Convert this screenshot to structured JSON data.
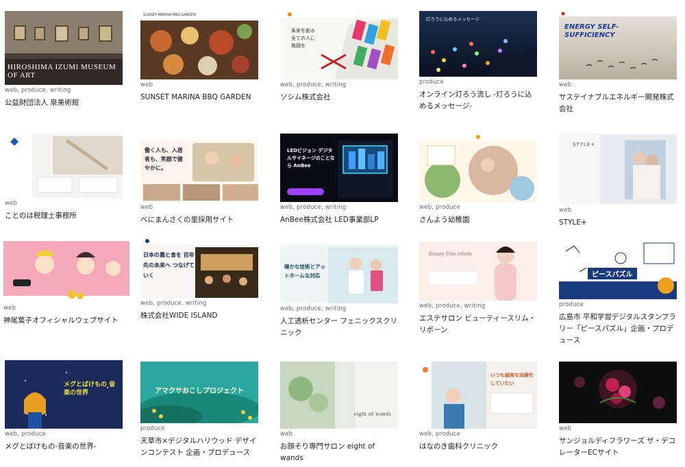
{
  "works": [
    {
      "tags": "web, produce, writing",
      "title": "公益財団法人 泉美術館",
      "thumb_text": "HIROSHIMA IZUMI MUSEUM OF ART"
    },
    {
      "tags": "web",
      "title": "SUNSET MARINA BBQ GARDEN",
      "thumb_text": "SUNSET MARINA BBQ GARDEN"
    },
    {
      "tags": "web, produce, writing",
      "title": "ソシム株式会社",
      "thumb_text": "未来を創る全ての人に笑顔を"
    },
    {
      "tags": "produce",
      "title": "オンライン灯ろう流し -灯ろうに込めるメッセージ-",
      "thumb_text": "灯ろうに込めるメッセージ"
    },
    {
      "tags": "web",
      "title": "サステイナブルエネルギー開発株式会社",
      "thumb_text": "ENERGY SELF-SUFFICIENCY"
    },
    {
      "tags": "web",
      "title": "ことのは税理士事務所",
      "thumb_text": ""
    },
    {
      "tags": "web",
      "title": "べにまんさくの里採用サイト",
      "thumb_text": "働く人も、入居者も、笑顔で健やかに。"
    },
    {
      "tags": "web, produce, writing",
      "title": "AnBee株式会社 LED事業部LP",
      "thumb_text": "LEDビジョン デジタルサイネージのことなら AnBee"
    },
    {
      "tags": "web, produce",
      "title": "さんよう幼稚園",
      "thumb_text": ""
    },
    {
      "tags": "web",
      "title": "STYLE+",
      "thumb_text": "STYLE+"
    },
    {
      "tags": "web",
      "title": "神尾葉子オフィシャルウェブサイト",
      "thumb_text": ""
    },
    {
      "tags": "web, produce, writing",
      "title": "株式会社WIDE ISLAND",
      "thumb_text": "日本の農と食を 百年先の未来へ つなげていく"
    },
    {
      "tags": "web, produce, writing",
      "title": "人工透析センター フェニックスクリニック",
      "thumb_text": "確かな技術とアットホームな対応"
    },
    {
      "tags": "web, produce, writing",
      "title": "エステサロン ビューティースリム・リボーン",
      "thumb_text": "Beauty Slim reborn"
    },
    {
      "tags": "produce",
      "title": "広島市 平和学習デジタルスタンプラリー「ピースパズル」企画・プロデュース",
      "thumb_text": "ピースパズル"
    },
    {
      "tags": "web, produce",
      "title": "メグとばけもの-音楽の世界-",
      "thumb_text": "メグとばけもの 音楽の世界"
    },
    {
      "tags": "produce",
      "title": "天草市×デジタルハリウッド デザインコンテスト 企画・プロデュース",
      "thumb_text": "アマクサおこしプロジェクト"
    },
    {
      "tags": "web",
      "title": "お顔そり専門サロン eight of wands",
      "thumb_text": "eight of wands"
    },
    {
      "tags": "web, produce",
      "title": "はなのき歯科クリニック",
      "thumb_text": "いつも誠実な治療をしていたい"
    },
    {
      "tags": "web",
      "title": "サンジョルディフラワーズ ザ・デコレーターECサイト",
      "thumb_text": ""
    }
  ]
}
